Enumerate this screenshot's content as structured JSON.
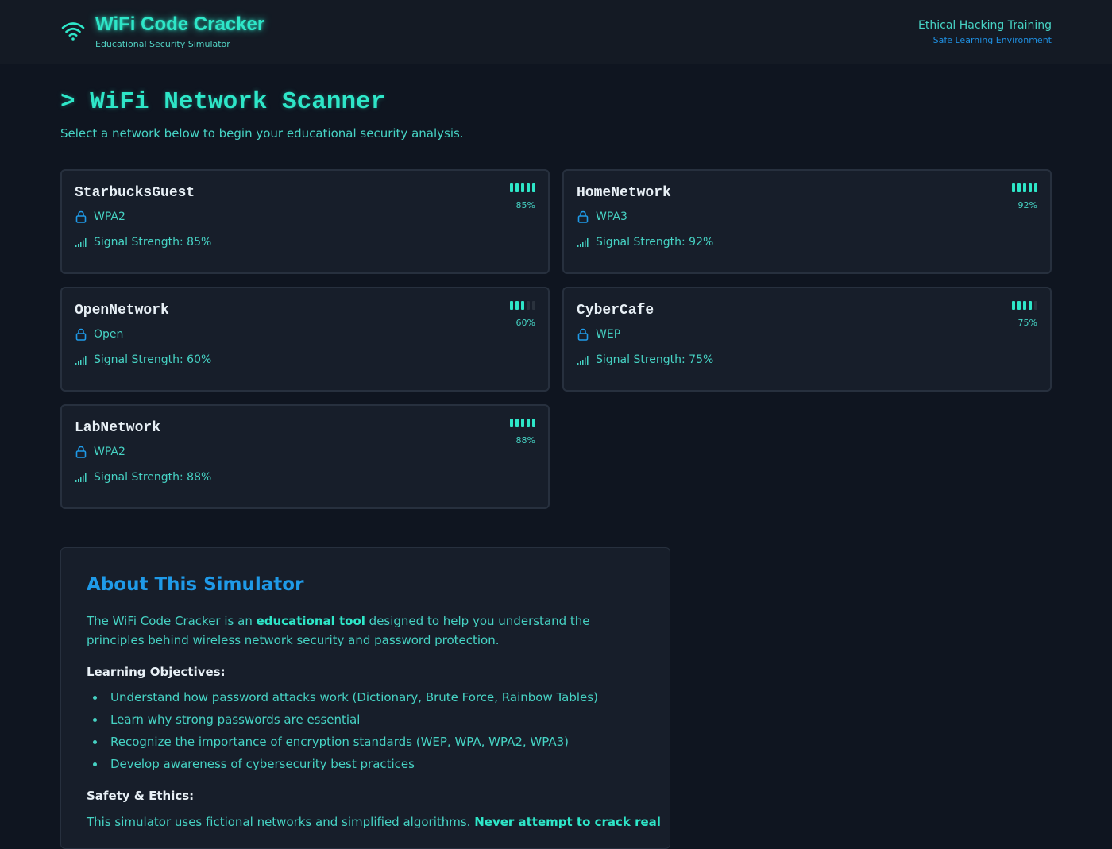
{
  "header": {
    "icon": "wifi-icon",
    "title": "WiFi Code Cracker",
    "subtitle": "Educational Security Simulator",
    "right_title": "Ethical Hacking Training",
    "right_subtitle": "Safe Learning Environment"
  },
  "page": {
    "title": "> WiFi Network Scanner",
    "subtitle": "Select a network below to begin your educational security analysis."
  },
  "colors": {
    "accent": "#2ee6c8",
    "text": "#46d3c4",
    "blue": "#1f9ae8",
    "background": "#0f1520",
    "card": "#171e2a"
  },
  "networks": [
    {
      "name": "StarbucksGuest",
      "security": "WPA2",
      "signal_label": "Signal Strength: 85%",
      "pct_label": "85%",
      "signal": 85,
      "bars_on": 5
    },
    {
      "name": "HomeNetwork",
      "security": "WPA3",
      "signal_label": "Signal Strength: 92%",
      "pct_label": "92%",
      "signal": 92,
      "bars_on": 5
    },
    {
      "name": "OpenNetwork",
      "security": "Open",
      "signal_label": "Signal Strength: 60%",
      "pct_label": "60%",
      "signal": 60,
      "bars_on": 3
    },
    {
      "name": "CyberCafe",
      "security": "WEP",
      "signal_label": "Signal Strength: 75%",
      "pct_label": "75%",
      "signal": 75,
      "bars_on": 4
    },
    {
      "name": "LabNetwork",
      "security": "WPA2",
      "signal_label": "Signal Strength: 88%",
      "pct_label": "88%",
      "signal": 88,
      "bars_on": 5
    }
  ],
  "about": {
    "title": "About This Simulator",
    "intro_pre": "The WiFi Code Cracker is an ",
    "intro_bold": "educational tool",
    "intro_post": " designed to help you understand the principles behind wireless network security and password protection.",
    "objectives_heading": "Learning Objectives:",
    "objectives": [
      "Understand how password attacks work (Dictionary, Brute Force, Rainbow Tables)",
      "Learn why strong passwords are essential",
      "Recognize the importance of encryption standards (WEP, WPA, WPA2, WPA3)",
      "Develop awareness of cybersecurity best practices"
    ],
    "safety_heading": "Safety & Ethics:",
    "safety_pre": "This simulator uses fictional networks and simplified algorithms. ",
    "safety_bold": "Never attempt to crack real"
  }
}
